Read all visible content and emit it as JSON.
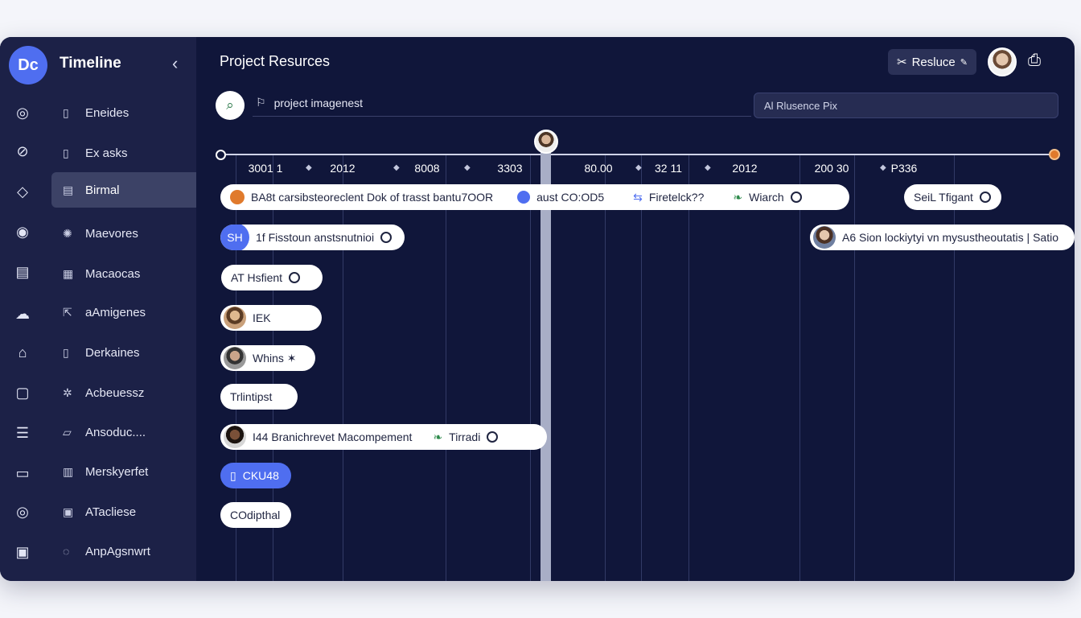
{
  "app": {
    "title": "Timeline",
    "logo_text": "Dc",
    "collapse_icon": "chevron-left-icon"
  },
  "sidebar": {
    "items": [
      {
        "label": "Eneides",
        "icon": "calendar-icon"
      },
      {
        "label": "Ex asks",
        "icon": "tasks-icon"
      },
      {
        "label": "Birmal",
        "icon": "document-icon",
        "active": true
      },
      {
        "label": "Maevores",
        "icon": "spinner-icon"
      },
      {
        "label": "Macaocas",
        "icon": "grid-icon"
      },
      {
        "label": "aAmigenes",
        "icon": "share-icon"
      },
      {
        "label": "Derkaines",
        "icon": "document-icon"
      },
      {
        "label": "Acbeuessz",
        "icon": "settings-icon"
      },
      {
        "label": "Ansoduc....",
        "icon": "edit-icon"
      },
      {
        "label": "Merskyerfet",
        "icon": "chart-icon"
      },
      {
        "label": "ATacliese",
        "icon": "box-icon"
      },
      {
        "label": "AnpAgsnwrt",
        "icon": "help-icon"
      }
    ],
    "rail_icons": [
      "headset-icon",
      "search-icon",
      "diamond-icon",
      "location-icon",
      "inbox-icon",
      "cloud-icon",
      "home-icon",
      "phone-icon",
      "layers-icon",
      "message-icon",
      "target-icon",
      "calendar-icon"
    ]
  },
  "header": {
    "title": "Project Resurces",
    "reschedule_label": "Resluce",
    "breadcrumb": "project imagenest",
    "filter_placeholder": "Al Rlusence Pix"
  },
  "timeline": {
    "ticks": [
      "3001 1",
      "2012",
      "8008",
      "3303",
      "80.00",
      "32 11",
      "2012",
      "200 30",
      "P336"
    ],
    "rows": [
      {
        "segments": [
          {
            "text": "BA8t carsibsteoreclent Dok of trasst bantu7OOR"
          },
          {
            "text": "aust CO:OD5"
          },
          {
            "text": "Firetelck??"
          },
          {
            "text": "Wiarch"
          }
        ]
      },
      {
        "extra": "SeiL Tfigant"
      },
      {
        "badge": "SH",
        "text": "1f Fisstoun anstsnutnioi"
      },
      {
        "text": "A6 Sion lockiytyi vn mysustheoutatis | Satio"
      },
      {
        "text": "AT Hsfient"
      },
      {
        "text": "IEK"
      },
      {
        "text": "Whins ✶"
      },
      {
        "text": "Trlintipst"
      },
      {
        "text": "I44 Branichrevet Macompement",
        "extra": "Tirradi"
      },
      {
        "text": "CKU48"
      },
      {
        "text": "COdipthal"
      }
    ]
  }
}
